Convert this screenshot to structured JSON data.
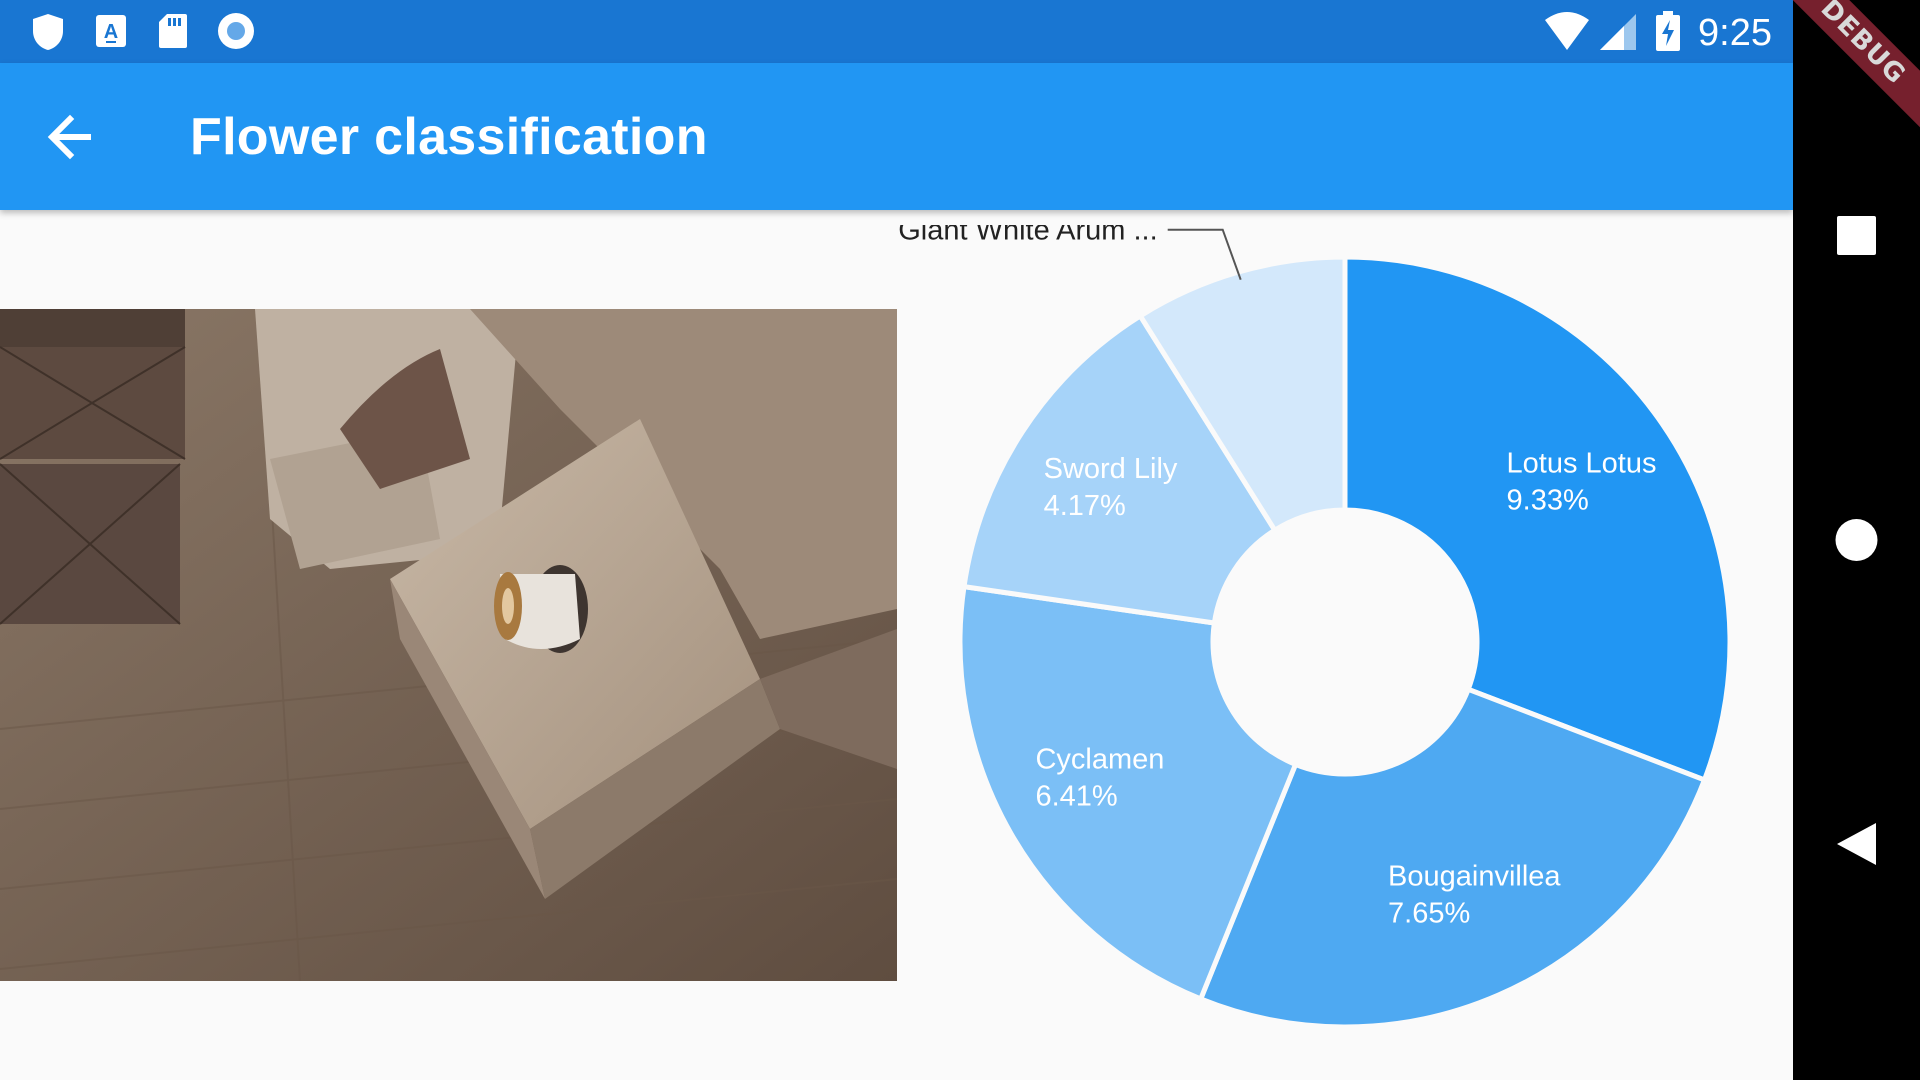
{
  "status_bar": {
    "time": "9:25",
    "icons": [
      "shield-icon",
      "keyboard-a-icon",
      "sd-card-icon",
      "record-icon",
      "wifi-icon",
      "cell-signal-icon",
      "battery-charging-icon"
    ]
  },
  "debug_banner": "DEBUG",
  "app_bar": {
    "title": "Flower classification",
    "back_icon": "arrow-back-icon",
    "color": "#2196f3"
  },
  "chart_data": {
    "type": "pie",
    "donut": true,
    "slices": [
      {
        "label": "Lotus Lotus",
        "value_label": "9.33%",
        "value": 9.33,
        "color": "#2196f3"
      },
      {
        "label": "Bougainvillea",
        "value_label": "7.65%",
        "value": 7.65,
        "color": "#4ea9f2"
      },
      {
        "label": "Cyclamen",
        "value_label": "6.41%",
        "value": 6.41,
        "color": "#7bbff6"
      },
      {
        "label": "Sword Lily",
        "value_label": "4.17%",
        "value": 4.17,
        "color": "#a6d3f9"
      },
      {
        "label": "Giant White Arum ...",
        "value_label": "",
        "value": 2.7,
        "color": "#d3e8fb"
      }
    ]
  },
  "nav_bar": {
    "icons": [
      "recents-square-icon",
      "home-circle-icon",
      "back-triangle-icon"
    ]
  }
}
